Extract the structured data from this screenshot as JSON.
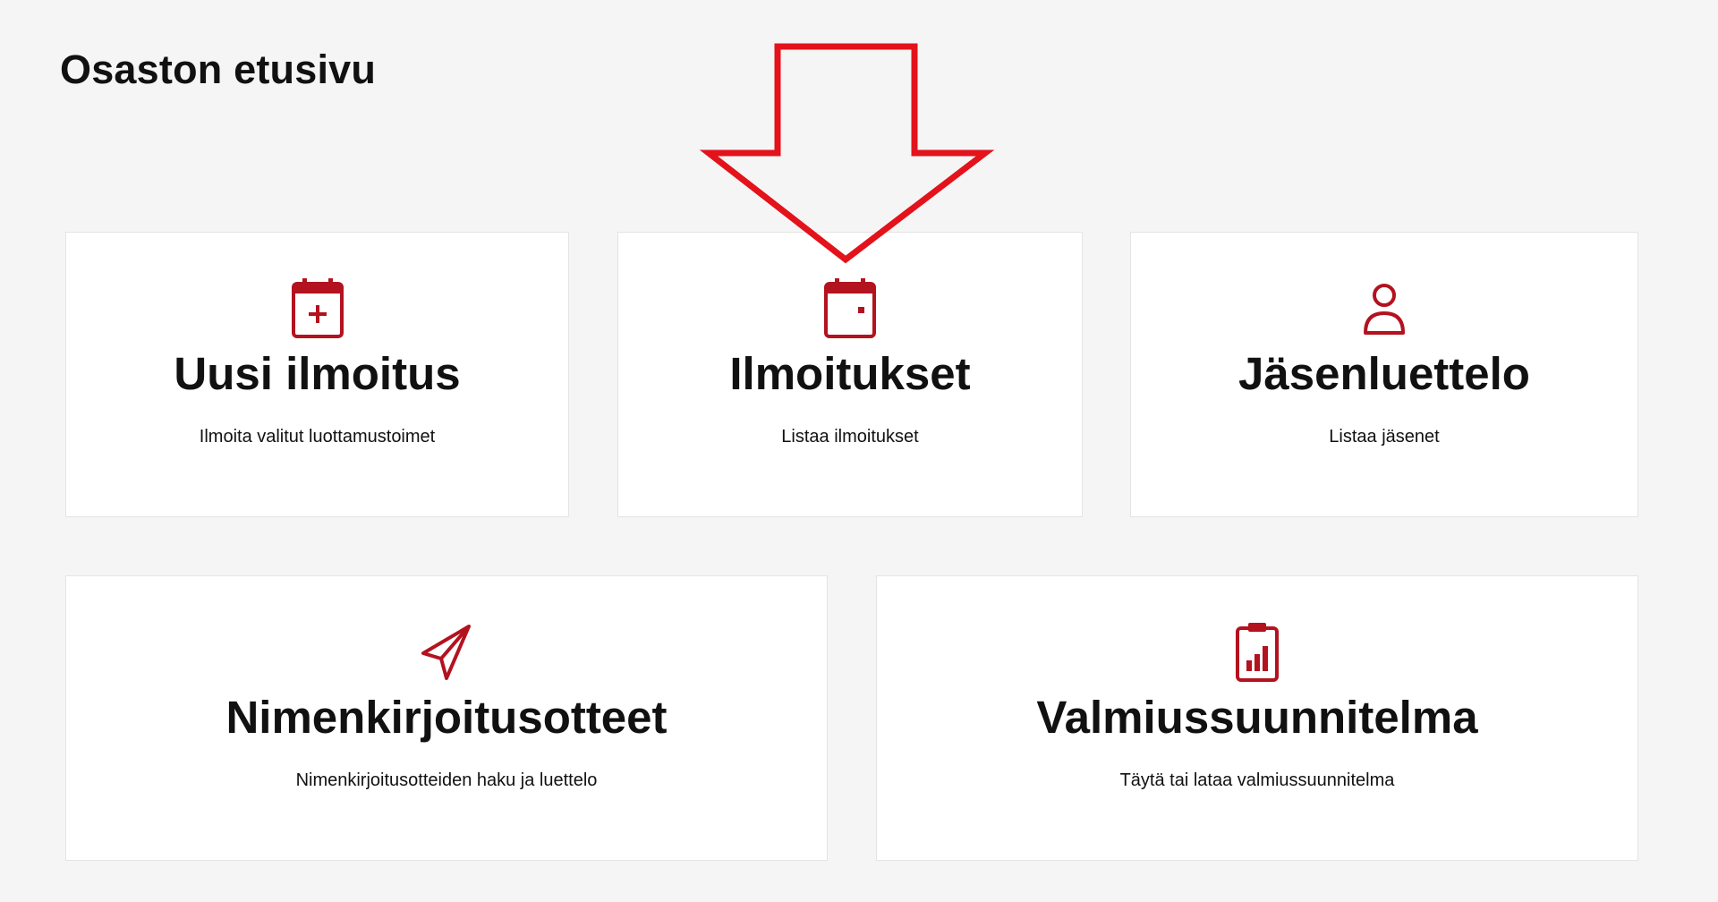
{
  "page": {
    "title": "Osaston etusivu"
  },
  "colors": {
    "background": "#f5f5f5",
    "card_background": "#ffffff",
    "icon_accent": "#b3121f",
    "annotation_arrow": "#e3121b"
  },
  "cards": [
    {
      "title": "Uusi ilmoitus",
      "description": "Ilmoita valitut luottamustoimet",
      "icon": "calendar-plus-icon"
    },
    {
      "title": "Ilmoitukset",
      "description": "Listaa ilmoitukset",
      "icon": "calendar-icon"
    },
    {
      "title": "Jäsenluettelo",
      "description": "Listaa jäsenet",
      "icon": "user-icon"
    },
    {
      "title": "Nimenkirjoitusotteet",
      "description": "Nimenkirjoitusotteiden haku ja luettelo",
      "icon": "paper-plane-icon"
    },
    {
      "title": "Valmiussuunnitelma",
      "description": "Täytä tai lataa valmiussuunnitelma",
      "icon": "clipboard-chart-icon"
    }
  ]
}
